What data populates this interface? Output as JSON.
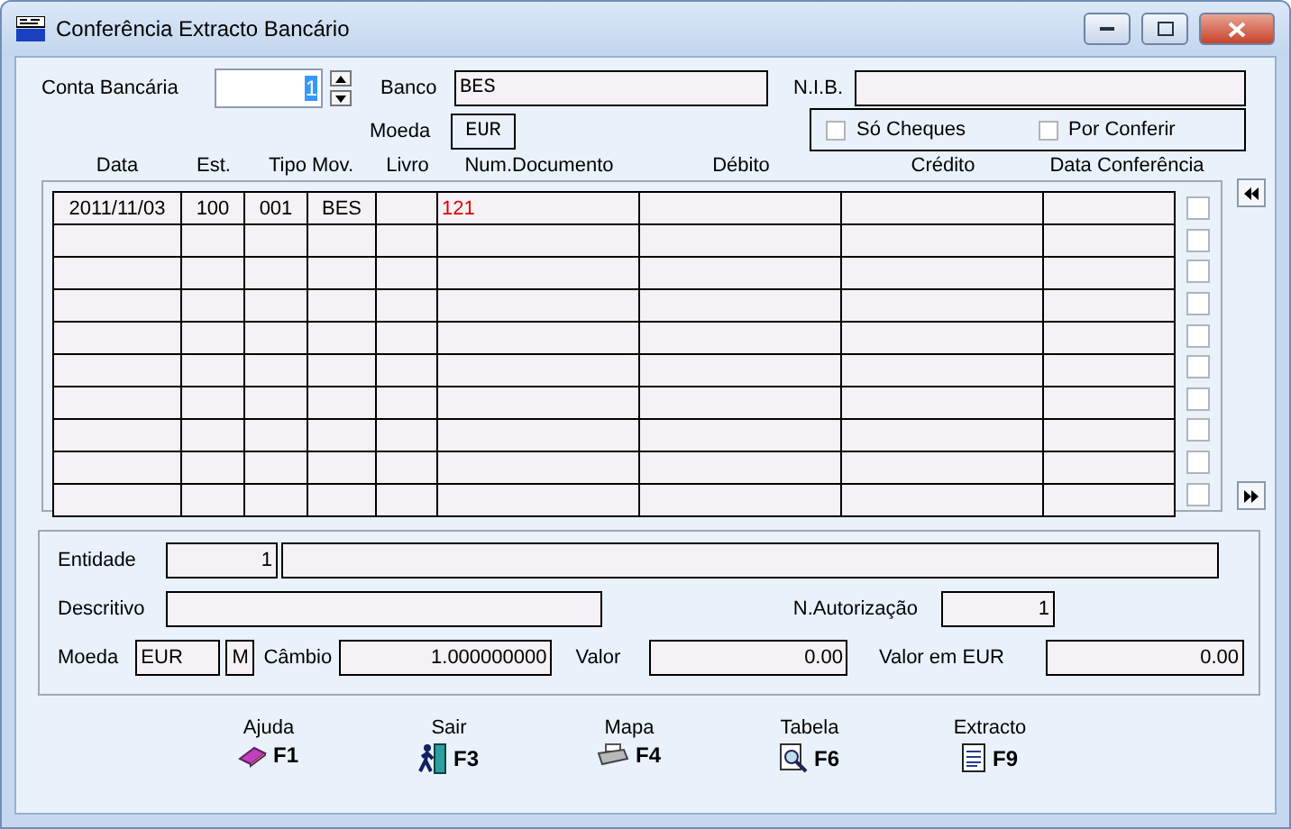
{
  "window": {
    "title": "Conferência Extracto Bancário"
  },
  "header": {
    "conta_label": "Conta Bancária",
    "conta_value": "1",
    "banco_label": "Banco",
    "banco_value": "BES",
    "nib_label": "N.I.B.",
    "moeda_label": "Moeda",
    "moeda_value": "EUR",
    "filters": [
      {
        "label": "Só Cheques",
        "checked": false
      },
      {
        "label": "Por Conferir",
        "checked": false
      }
    ]
  },
  "table": {
    "columns": [
      "Data",
      "Est.",
      "Tipo Mov.",
      "Livro",
      "Num.Documento",
      "Débito",
      "Crédito",
      "Data Conferência"
    ],
    "rows": [
      {
        "cells": [
          "2011/11/03",
          "100",
          "001",
          "BES",
          null,
          "121",
          null,
          null,
          null
        ],
        "checked": false
      },
      {
        "checked": false
      },
      {
        "checked": false
      },
      {
        "checked": false
      },
      {
        "checked": false
      },
      {
        "checked": false
      },
      {
        "checked": false
      },
      {
        "checked": false
      },
      {
        "checked": false
      },
      {
        "checked": false
      }
    ]
  },
  "details": {
    "entidade_label": "Entidade",
    "entidade_value": "1",
    "descritivo_label": "Descritivo",
    "autorizacao_label": "N.Autorização",
    "autorizacao_value": "1",
    "moeda_label": "Moeda",
    "moeda_value": "EUR",
    "moeda_flag": "M",
    "cambio_label": "Câmbio",
    "cambio_value": "1.000000000",
    "valor_label": "Valor",
    "valor_value": "0.00",
    "valor_eur_label": "Valor em EUR",
    "valor_eur_value": "0.00"
  },
  "function_keys": [
    {
      "label": "Ajuda",
      "key": "F1",
      "kind": "help"
    },
    {
      "label": "Sair",
      "key": "F3",
      "kind": "exit"
    },
    {
      "label": "Mapa",
      "key": "F4",
      "kind": "print"
    },
    {
      "label": "Tabela",
      "key": "F6",
      "kind": "search"
    },
    {
      "label": "Extracto",
      "key": "F9",
      "kind": "document"
    }
  ]
}
